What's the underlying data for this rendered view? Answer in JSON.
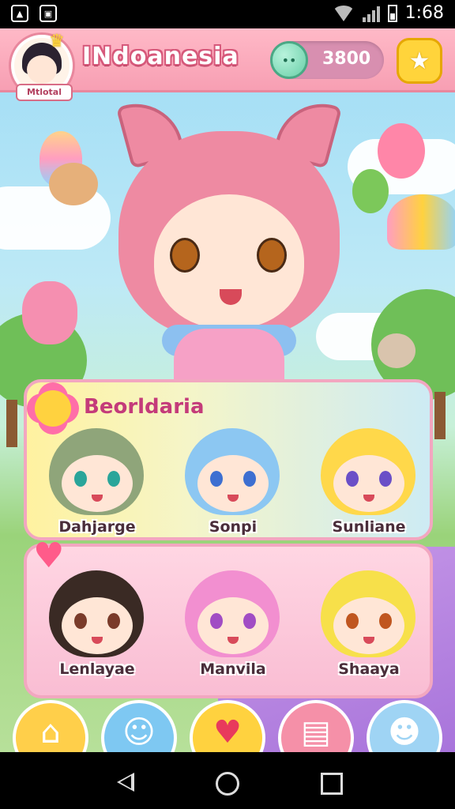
{
  "status_bar": {
    "time": "1:68",
    "left_icons": [
      "photo-icon",
      "notification-icon"
    ]
  },
  "header": {
    "title": "INdoanesia",
    "avatar_badge": "Mtlotal",
    "currency_value": "3800",
    "crown_icon": "crown-icon",
    "coin_icon": "coin-icon",
    "star_icon": "star-icon"
  },
  "panel_one": {
    "title": "Beorldaria",
    "characters": [
      {
        "name": "Dahjarge"
      },
      {
        "name": "Sonpi"
      },
      {
        "name": "Sunliane"
      }
    ]
  },
  "panel_two": {
    "characters": [
      {
        "name": "Lenlayae"
      },
      {
        "name": "Manvila"
      },
      {
        "name": "Shaaya"
      }
    ]
  },
  "bottom_nav": [
    {
      "icon": "home-icon",
      "glyph": "⌂",
      "color": "#ffcf4a"
    },
    {
      "icon": "ghost-icon",
      "glyph": "☺",
      "color": "#7ec8f2"
    },
    {
      "icon": "heart-icon",
      "glyph": "♥",
      "color": "#ffd23f"
    },
    {
      "icon": "document-icon",
      "glyph": "▤",
      "color": "#f590a8"
    },
    {
      "icon": "cat-icon",
      "glyph": "☻",
      "color": "#9fd4f4"
    }
  ],
  "colors": {
    "accent_pink": "#f79fb3",
    "title_outline": "#d6587a",
    "currency_pill": "#d88fb0",
    "star_button": "#ffd43b"
  }
}
